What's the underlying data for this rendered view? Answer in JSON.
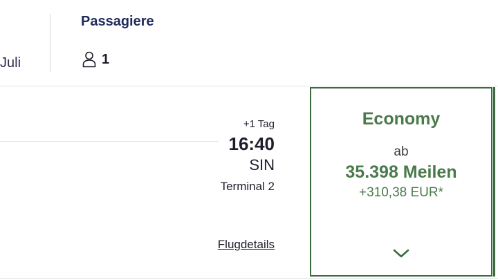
{
  "search_bar": {
    "date_fragment": "Juli",
    "passengers_label": "Passagiere",
    "passengers_count": "1",
    "passengers_icon": "person-icon"
  },
  "flight": {
    "arrival": {
      "day_offset": "+1 Tag",
      "time": "16:40",
      "airport_code": "SIN",
      "terminal": "Terminal 2"
    },
    "details_link": "Flugdetails"
  },
  "fare": {
    "class_name": "Economy",
    "from_label": "ab",
    "miles": "35.398 Meilen",
    "surcharge": "+310,38 EUR*",
    "expand_icon": "chevron-down-icon"
  },
  "colors": {
    "accent_green": "#4a7a4b",
    "border_green": "#3c6b3e",
    "navy_text": "#1f2a5a"
  }
}
